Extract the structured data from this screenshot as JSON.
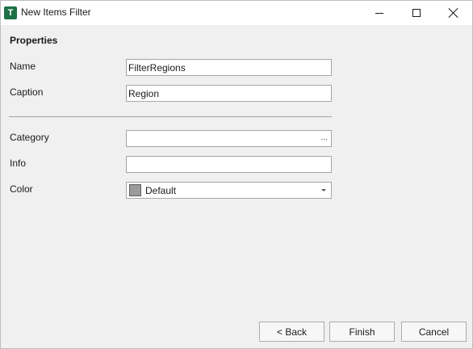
{
  "window": {
    "title": "New Items Filter",
    "icon_letter": "T",
    "accent_color": "#1e7145"
  },
  "section": {
    "title": "Properties"
  },
  "fields": {
    "name": {
      "label": "Name",
      "value": "FilterRegions"
    },
    "caption": {
      "label": "Caption",
      "value": "Region"
    },
    "category": {
      "label": "Category",
      "value": "",
      "browse_label": "..."
    },
    "info": {
      "label": "Info",
      "value": ""
    },
    "color": {
      "label": "Color",
      "value": "Default",
      "swatch_color": "#9a9a9a"
    }
  },
  "buttons": {
    "back": "< Back",
    "finish": "Finish",
    "cancel": "Cancel"
  }
}
